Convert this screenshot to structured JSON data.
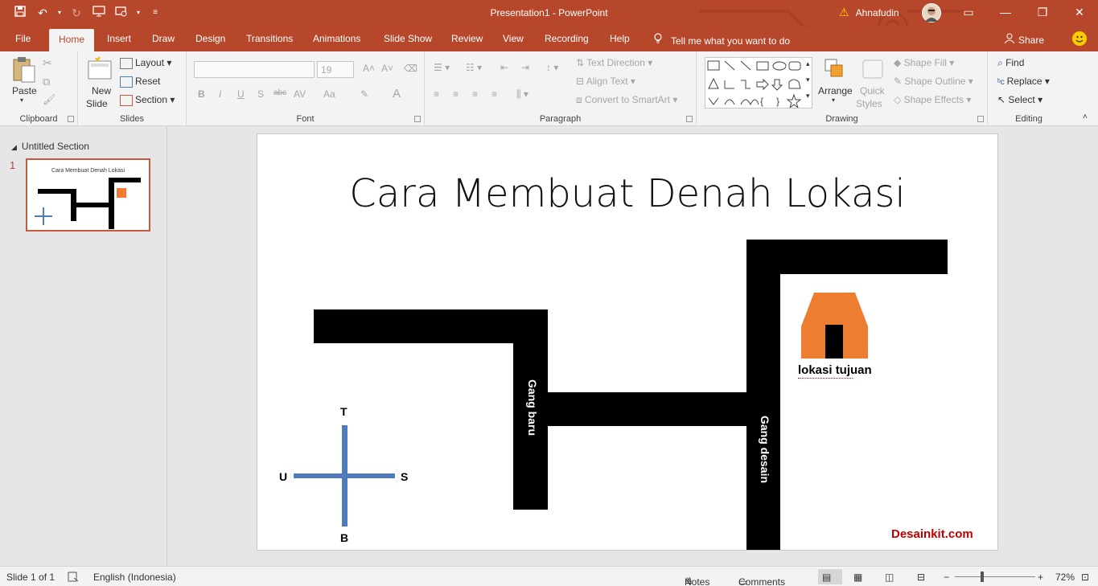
{
  "titlebar": {
    "doc_title": "Presentation1 - PowerPoint",
    "user_name": "Ahnafudin",
    "warning_icon": "warning-icon",
    "minimize": "—",
    "restore": "❐",
    "close": "✕",
    "ribbon_display": "▭"
  },
  "tabs": [
    "File",
    "Home",
    "Insert",
    "Draw",
    "Design",
    "Transitions",
    "Animations",
    "Slide Show",
    "Review",
    "View",
    "Recording",
    "Help"
  ],
  "active_tab": "Home",
  "tell_me": "Tell me what you want to do",
  "share": "Share",
  "ribbon": {
    "clipboard": {
      "label": "Clipboard",
      "paste": "Paste"
    },
    "slides": {
      "label": "Slides",
      "new_slide_1": "New",
      "new_slide_2": "Slide",
      "layout": "Layout",
      "reset": "Reset",
      "section": "Section"
    },
    "font": {
      "label": "Font",
      "font_name": "",
      "font_size": "19",
      "bold": "B",
      "italic": "I",
      "underline": "U",
      "shadow": "S",
      "strike": "abc",
      "spacing": "AV",
      "case": "Aa",
      "color": "A"
    },
    "paragraph": {
      "label": "Paragraph",
      "text_direction": "Text Direction",
      "align_text": "Align Text",
      "smartart": "Convert to SmartArt"
    },
    "drawing": {
      "label": "Drawing",
      "arrange": "Arrange",
      "quick_1": "Quick",
      "quick_2": "Styles",
      "shape_fill": "Shape Fill",
      "shape_outline": "Shape Outline",
      "shape_effects": "Shape Effects"
    },
    "editing": {
      "label": "Editing",
      "find": "Find",
      "replace": "Replace",
      "select": "Select"
    }
  },
  "left_pane": {
    "section_name": "Untitled Section",
    "slide_number": "1",
    "thumb_title": "Cara Membuat Denah Lokasi"
  },
  "slide": {
    "title": "Cara Membuat Denah Lokasi",
    "road_label_1": "Gang baru",
    "road_label_2": "Gang desain",
    "destination_label": "lokasi tujuan",
    "watermark": "Desainkit.com",
    "compass": {
      "north": "T",
      "south": "B",
      "west": "U",
      "east": "S"
    },
    "colors": {
      "road": "#000000",
      "house": "#ed7d31",
      "compass": "#4f7bbe",
      "watermark": "#c00000",
      "accent": "#b7472a"
    }
  },
  "status": {
    "slide_info": "Slide 1 of 1",
    "language": "English (Indonesia)",
    "notes": "Notes",
    "comments": "Comments",
    "zoom": "72%"
  }
}
